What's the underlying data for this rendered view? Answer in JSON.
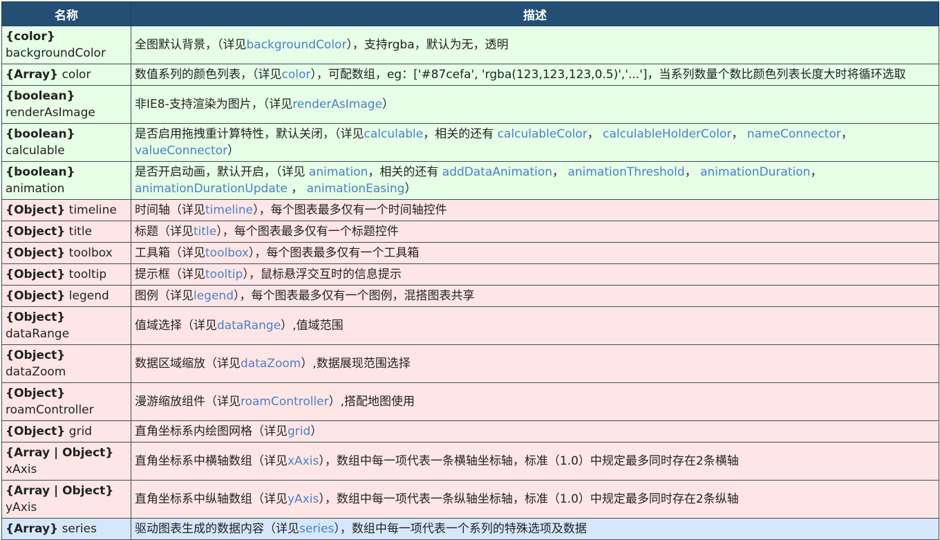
{
  "colors": {
    "header_bg": "#244f75",
    "header_text": "#ffffff",
    "row_green": "#e6ffe6",
    "row_red": "#ffe6e6",
    "row_blue": "#d6e7fb",
    "link": "#4a80c8"
  },
  "table": {
    "headers": {
      "name": "名称",
      "desc": "描述"
    },
    "rows": [
      {
        "tone": "green",
        "type": "{color}",
        "name_break": true,
        "name": "backgroundColor",
        "desc": [
          {
            "t": "全图默认背景，（详见"
          },
          {
            "t": "backgroundColor",
            "link": true
          },
          {
            "t": "），支持rgba，默认为无，透明"
          }
        ]
      },
      {
        "tone": "green",
        "type": "{Array}",
        "name_break": false,
        "name": "color",
        "desc": [
          {
            "t": "数值系列的颜色列表，（详见"
          },
          {
            "t": "color",
            "link": true
          },
          {
            "t": "），可配数组，eg：['#87cefa', 'rgba(123,123,123,0.5)','...']，当系列数量个数比颜色列表长度大时将循环选取"
          }
        ]
      },
      {
        "tone": "green",
        "type": "{boolean}",
        "name_break": true,
        "name": "renderAsImage",
        "desc": [
          {
            "t": "非IE8-支持渲染为图片，（详见"
          },
          {
            "t": "renderAsImage",
            "link": true
          },
          {
            "t": "）"
          }
        ]
      },
      {
        "tone": "green",
        "type": "{boolean}",
        "name_break": false,
        "name": "calculable",
        "desc": [
          {
            "t": "是否启用拖拽重计算特性，默认关闭，（详见"
          },
          {
            "t": "calculable",
            "link": true
          },
          {
            "t": "，相关的还有 "
          },
          {
            "t": "calculableColor",
            "link": true
          },
          {
            "t": "， "
          },
          {
            "t": "calculableHolderColor",
            "link": true
          },
          {
            "t": "， "
          },
          {
            "t": "nameConnector",
            "link": true
          },
          {
            "t": "， "
          },
          {
            "t": "valueConnector",
            "link": true
          },
          {
            "t": "）"
          }
        ]
      },
      {
        "tone": "green",
        "type": "{boolean}",
        "name_break": false,
        "name": "animation",
        "desc": [
          {
            "t": "是否开启动画，默认开启，（详见 "
          },
          {
            "t": "animation",
            "link": true
          },
          {
            "t": "，相关的还有 "
          },
          {
            "t": "addDataAnimation",
            "link": true
          },
          {
            "t": "， "
          },
          {
            "t": "animationThreshold",
            "link": true
          },
          {
            "t": "， "
          },
          {
            "t": "animationDuration",
            "link": true
          },
          {
            "t": "， "
          },
          {
            "t": "animationDurationUpdate",
            "link": true
          },
          {
            "t": " ， "
          },
          {
            "t": "animationEasing",
            "link": true
          },
          {
            "t": "）"
          }
        ]
      },
      {
        "tone": "red",
        "type": "{Object}",
        "name_break": false,
        "name": "timeline",
        "desc": [
          {
            "t": "时间轴（详见"
          },
          {
            "t": "timeline",
            "link": true
          },
          {
            "t": "），每个图表最多仅有一个时间轴控件"
          }
        ]
      },
      {
        "tone": "red",
        "type": "{Object}",
        "name_break": false,
        "name": "title",
        "desc": [
          {
            "t": "标题（详见"
          },
          {
            "t": "title",
            "link": true
          },
          {
            "t": "），每个图表最多仅有一个标题控件"
          }
        ]
      },
      {
        "tone": "red",
        "type": "{Object}",
        "name_break": false,
        "name": "toolbox",
        "desc": [
          {
            "t": "工具箱（详见"
          },
          {
            "t": "toolbox",
            "link": true
          },
          {
            "t": "），每个图表最多仅有一个工具箱"
          }
        ]
      },
      {
        "tone": "red",
        "type": "{Object}",
        "name_break": false,
        "name": "tooltip",
        "desc": [
          {
            "t": "提示框（详见"
          },
          {
            "t": "tooltip",
            "link": true
          },
          {
            "t": "），鼠标悬浮交互时的信息提示"
          }
        ]
      },
      {
        "tone": "red",
        "type": "{Object}",
        "name_break": false,
        "name": "legend",
        "desc": [
          {
            "t": "图例（详见"
          },
          {
            "t": "legend",
            "link": true
          },
          {
            "t": "），每个图表最多仅有一个图例，混搭图表共享"
          }
        ]
      },
      {
        "tone": "red",
        "type": "{Object}",
        "name_break": false,
        "name": "dataRange",
        "desc": [
          {
            "t": "值域选择（详见"
          },
          {
            "t": "dataRange",
            "link": true
          },
          {
            "t": "）,值域范围"
          }
        ]
      },
      {
        "tone": "red",
        "type": "{Object}",
        "name_break": false,
        "name": "dataZoom",
        "desc": [
          {
            "t": "数据区域缩放（详见"
          },
          {
            "t": "dataZoom",
            "link": true
          },
          {
            "t": "）,数据展现范围选择"
          }
        ]
      },
      {
        "tone": "red",
        "type": "{Object}",
        "name_break": true,
        "name": "roamController",
        "desc": [
          {
            "t": "漫游缩放组件（详见"
          },
          {
            "t": "roamController",
            "link": true
          },
          {
            "t": "）,搭配地图使用"
          }
        ]
      },
      {
        "tone": "red",
        "type": "{Object}",
        "name_break": false,
        "name": "grid",
        "desc": [
          {
            "t": "直角坐标系内绘图网格（详见"
          },
          {
            "t": "grid",
            "link": true
          },
          {
            "t": "）"
          }
        ]
      },
      {
        "tone": "red",
        "type": "{Array | Object}",
        "name_break": true,
        "name": "xAxis",
        "desc": [
          {
            "t": "直角坐标系中横轴数组（详见"
          },
          {
            "t": "xAxis",
            "link": true
          },
          {
            "t": "），数组中每一项代表一条横轴坐标轴，标准（1.0）中规定最多同时存在2条横轴"
          }
        ]
      },
      {
        "tone": "red",
        "type": "{Array | Object}",
        "name_break": true,
        "name": "yAxis",
        "desc": [
          {
            "t": "直角坐标系中纵轴数组（详见"
          },
          {
            "t": "yAxis",
            "link": true
          },
          {
            "t": "），数组中每一项代表一条纵轴坐标轴，标准（1.0）中规定最多同时存在2条纵轴"
          }
        ]
      },
      {
        "tone": "blue",
        "type": "{Array}",
        "name_break": false,
        "name": "series",
        "desc": [
          {
            "t": "驱动图表生成的数据内容（详见"
          },
          {
            "t": "series",
            "link": true
          },
          {
            "t": "），数组中每一项代表一个系列的特殊选项及数据"
          }
        ]
      }
    ]
  }
}
